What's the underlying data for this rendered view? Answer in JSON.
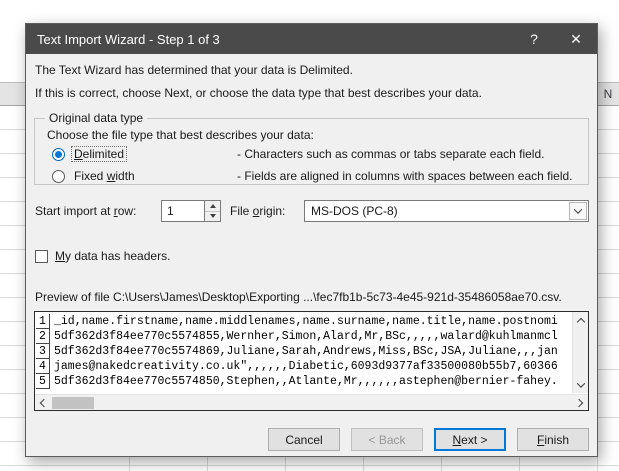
{
  "titlebar": {
    "title": "Text Import Wizard - Step 1 of 3",
    "help_glyph": "?",
    "close_glyph": "✕"
  },
  "intro": {
    "line1": "The Text Wizard has determined that your data is Delimited.",
    "line2": "If this is correct, choose Next, or choose the data type that best describes your data."
  },
  "group": {
    "legend": "Original data type",
    "prompt": "Choose the file type that best describes your data:",
    "options": [
      {
        "pre": "",
        "key": "D",
        "post": "elimited",
        "selected": true,
        "desc": "- Characters such as commas or tabs separate each field."
      },
      {
        "pre": "Fixed ",
        "key": "w",
        "post": "idth",
        "selected": false,
        "desc": "- Fields are aligned in columns with spaces between each field."
      }
    ]
  },
  "import_row": {
    "pre": "Start import at ",
    "key": "r",
    "post": "ow:",
    "value": "1"
  },
  "file_origin": {
    "pre": "File ",
    "key": "o",
    "post": "rigin:",
    "value": "MS-DOS (PC-8)"
  },
  "headers_checkbox": {
    "pre": "",
    "key": "M",
    "post": "y data has headers.",
    "checked": false
  },
  "preview": {
    "label": "Preview of file C:\\Users\\James\\Desktop\\Exporting ...\\fec7fb1b-5c73-4e45-921d-35486058ae70.csv.",
    "rows": [
      {
        "num": "1",
        "text": "_id,name.firstname,name.middlenames,name.surname,name.title,name.postnomi"
      },
      {
        "num": "2",
        "text": "5df362d3f84ee770c5574855,Wernher,Simon,Alard,Mr,BSc,,,,,walard@kuhlmanmcl"
      },
      {
        "num": "3",
        "text": "5df362d3f84ee770c5574869,Juliane,Sarah,Andrews,Miss,BSc,JSA,Juliane,,,jan"
      },
      {
        "num": "4",
        "text": "james@nakedcreativity.co.uk\",,,,,,Diabetic,6093d9377af33500080b55b7,60366"
      },
      {
        "num": "5",
        "text": "5df362d3f84ee770c5574850,Stephen,,Atlante,Mr,,,,,,astephen@bernier-fahey."
      }
    ]
  },
  "buttons": {
    "cancel": {
      "label": "Cancel"
    },
    "back": {
      "label": "< Back",
      "disabled": true
    },
    "next": {
      "pre": "",
      "key": "N",
      "post": "ext >",
      "default": true
    },
    "finish": {
      "pre": "",
      "key": "F",
      "post": "inish"
    }
  },
  "background": {
    "column_header": "N"
  },
  "colors": {
    "titlebar": "#4a4a4a",
    "dialog_bg": "#f0f0f0",
    "accent": "#0078d7",
    "grid_line": "#d9d9d9"
  }
}
